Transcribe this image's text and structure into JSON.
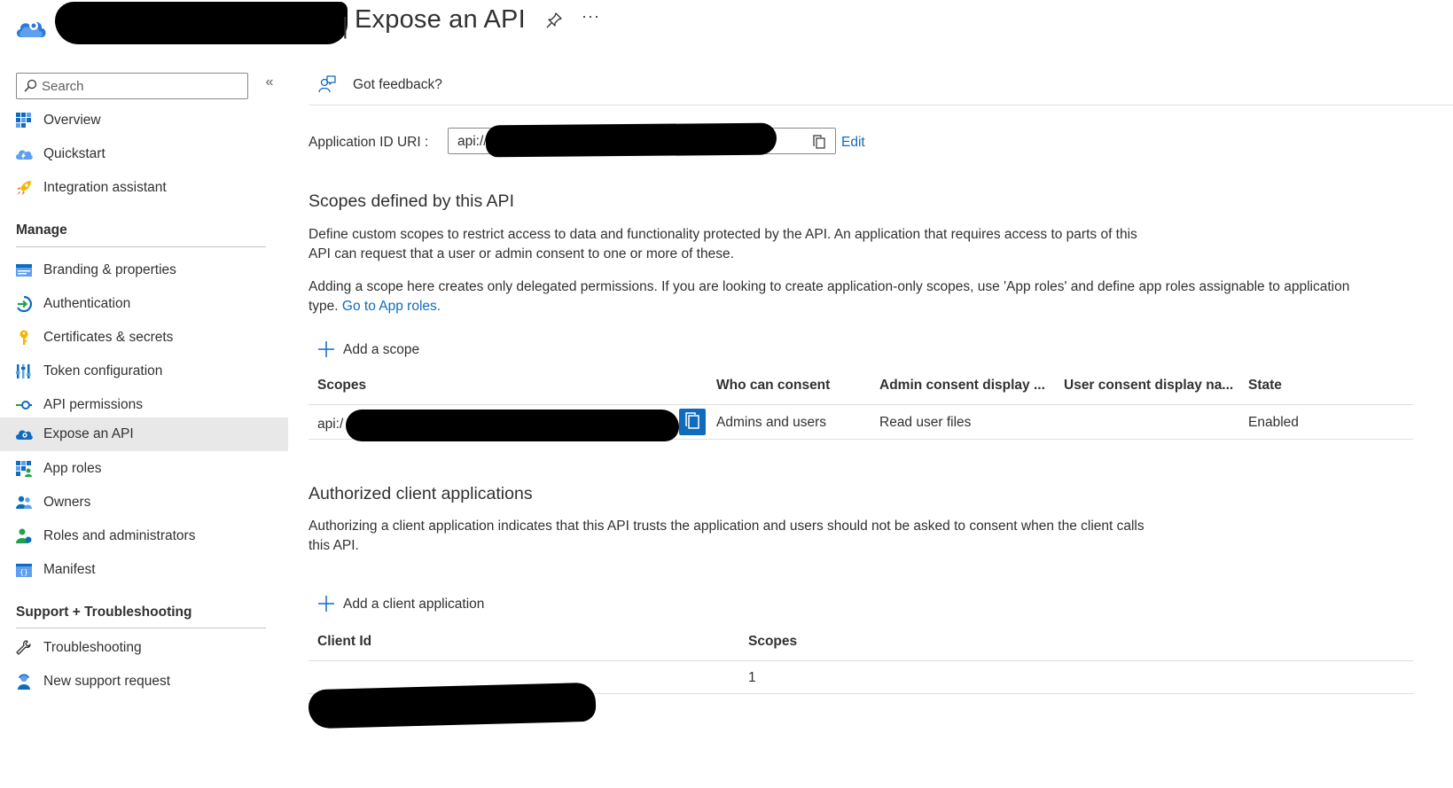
{
  "header": {
    "title_prefix": "|",
    "title": "Expose an API",
    "more_label": "···"
  },
  "sidebar": {
    "search_placeholder": "Search",
    "collapse_label": "«",
    "top_items": [
      {
        "label": "Overview",
        "icon": "overview-grid-icon"
      },
      {
        "label": "Quickstart",
        "icon": "quickstart-cloud-icon"
      },
      {
        "label": "Integration assistant",
        "icon": "rocket-icon"
      }
    ],
    "manage_heading": "Manage",
    "manage_items": [
      {
        "label": "Branding & properties",
        "icon": "branding-icon"
      },
      {
        "label": "Authentication",
        "icon": "authentication-icon"
      },
      {
        "label": "Certificates & secrets",
        "icon": "key-icon"
      },
      {
        "label": "Token configuration",
        "icon": "token-bars-icon"
      },
      {
        "label": "API permissions",
        "icon": "api-permissions-icon"
      },
      {
        "label": "Expose an API",
        "icon": "expose-api-cloud-icon",
        "selected": true
      },
      {
        "label": "App roles",
        "icon": "app-roles-icon"
      },
      {
        "label": "Owners",
        "icon": "owners-icon"
      },
      {
        "label": "Roles and administrators",
        "icon": "roles-admins-icon"
      },
      {
        "label": "Manifest",
        "icon": "manifest-icon"
      }
    ],
    "support_heading": "Support + Troubleshooting",
    "support_items": [
      {
        "label": "Troubleshooting",
        "icon": "wrench-icon"
      },
      {
        "label": "New support request",
        "icon": "support-person-icon"
      }
    ]
  },
  "main": {
    "feedback_label": "Got feedback?",
    "app_id_label": "Application ID URI :",
    "app_id_value": "api://",
    "edit_label": "Edit",
    "scopes_section": {
      "title": "Scopes defined by this API",
      "desc_line1": "Define custom scopes to restrict access to data and functionality protected by the API. An application that requires access to parts of this",
      "desc_line2": "API can request that a user or admin consent to one or more of these.",
      "note_line1": "Adding a scope here creates only delegated permissions. If you are looking to create application-only scopes, use 'App roles' and define app roles assignable to application",
      "note_line2_prefix": "type.",
      "note_link": "Go to App roles.",
      "add_label": "Add a scope",
      "columns": [
        "Scopes",
        "Who can consent",
        "Admin consent display ...",
        "User consent display na...",
        "State"
      ],
      "rows": [
        {
          "scope": "api:/",
          "who": "Admins and users",
          "admin_display": "Read user files",
          "user_display": "",
          "state": "Enabled"
        }
      ]
    },
    "clients_section": {
      "title": "Authorized client applications",
      "desc_line1": "Authorizing a client application indicates that this API trusts the application and users should not be asked to consent when the client calls",
      "desc_line2": "this API.",
      "add_label": "Add a client application",
      "columns": [
        "Client Id",
        "Scopes"
      ],
      "rows": [
        {
          "client_id": "",
          "scopes": "1"
        }
      ]
    }
  },
  "colors": {
    "link": "#0f6cbd",
    "selected_bg": "#e8e8e8",
    "text": "#323130",
    "redaction": "#000000"
  }
}
